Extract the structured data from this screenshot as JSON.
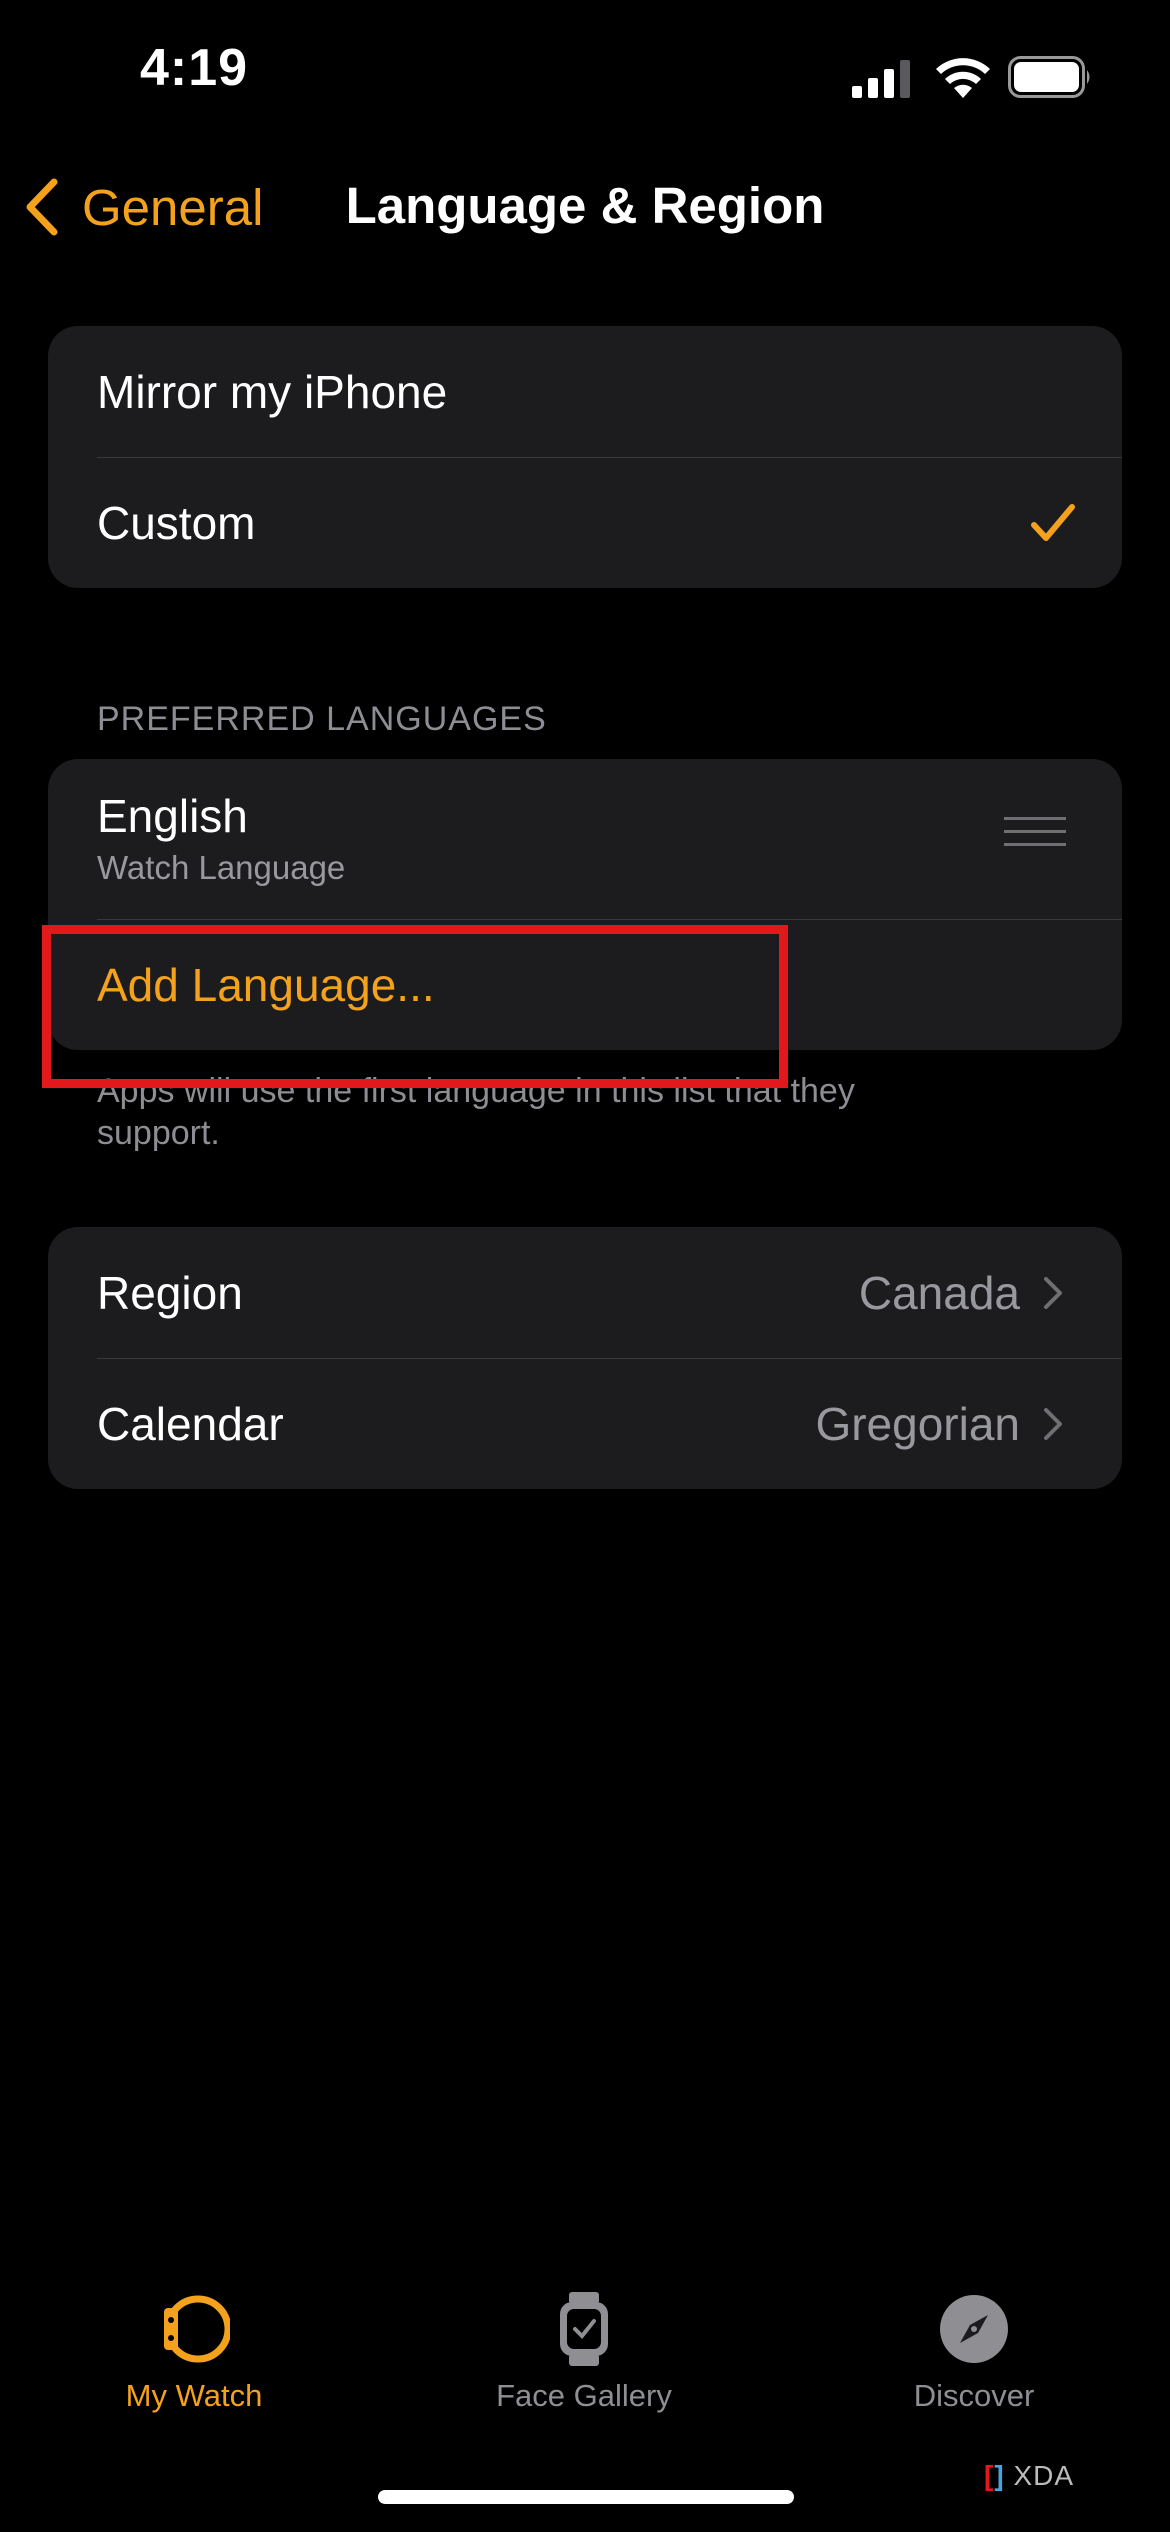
{
  "status_bar": {
    "time": "4:19"
  },
  "nav": {
    "back_label": "General",
    "title": "Language & Region"
  },
  "mode_options": [
    {
      "label": "Mirror my iPhone",
      "selected": false
    },
    {
      "label": "Custom",
      "selected": true
    }
  ],
  "preferred_languages": {
    "header": "PREFERRED LANGUAGES",
    "items": [
      {
        "name": "English",
        "subtitle": "Watch Language"
      }
    ],
    "add_label": "Add Language...",
    "footer": "Apps will use the first language in this list that they support."
  },
  "settings": [
    {
      "label": "Region",
      "value": "Canada"
    },
    {
      "label": "Calendar",
      "value": "Gregorian"
    }
  ],
  "tab_bar": {
    "tabs": [
      {
        "label": "My Watch",
        "icon": "watch-icon",
        "active": true
      },
      {
        "label": "Face Gallery",
        "icon": "watch-face-icon",
        "active": false
      },
      {
        "label": "Discover",
        "icon": "compass-icon",
        "active": false
      }
    ]
  },
  "watermark": "XDA",
  "colors": {
    "accent": "#f4a11c",
    "background": "#000000",
    "card": "#1c1c1e",
    "highlight": "#e3181c"
  }
}
